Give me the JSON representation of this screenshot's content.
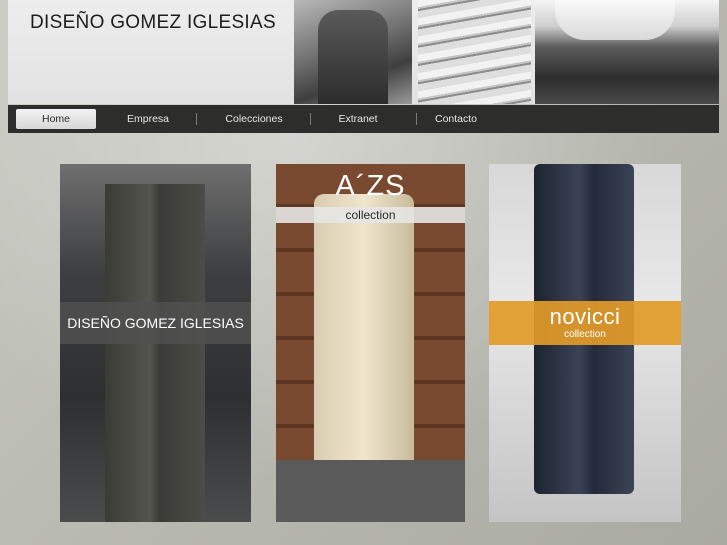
{
  "site": {
    "title": "DISEÑO GOMEZ IGLESIAS"
  },
  "nav": {
    "items": [
      {
        "label": "Home",
        "active": true
      },
      {
        "label": "Empresa",
        "active": false
      },
      {
        "label": "Colecciones",
        "active": false
      },
      {
        "label": "Extranet",
        "active": false
      },
      {
        "label": "Contacto",
        "active": false
      }
    ]
  },
  "collections": [
    {
      "label": "DISEÑO GOMEZ IGLESIAS"
    },
    {
      "brand": "A´ZS",
      "subtitle": "collection"
    },
    {
      "brand": "novicci",
      "subtitle": "collection",
      "accent": "#e29b28"
    }
  ],
  "colors": {
    "navbar": "#2d2d2b",
    "header": "#e8e8e8",
    "accent": "#e29b28"
  }
}
